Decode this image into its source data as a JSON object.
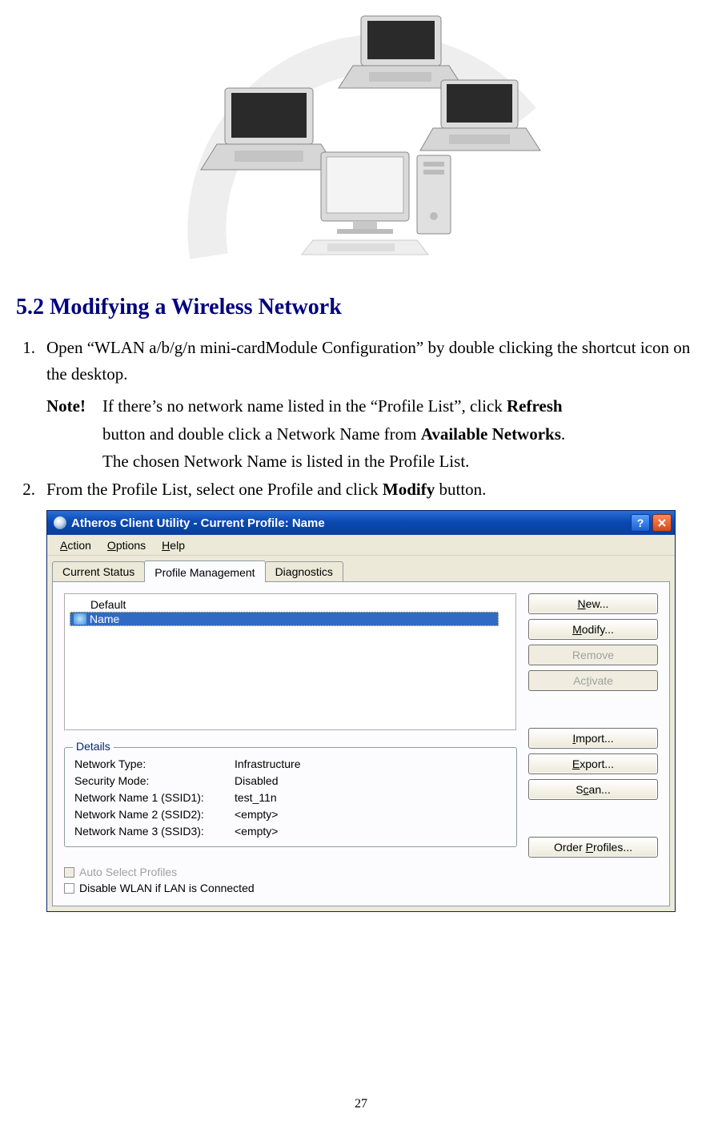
{
  "section_heading": "5.2 Modifying a Wireless Network",
  "steps": {
    "s1_num": "1.",
    "s1_text": "Open “WLAN a/b/g/n mini-cardModule Configuration” by double clicking the shortcut icon on the desktop.",
    "note_label": "Note!",
    "note_l1_pre": "If there’s no network name listed in the “Profile List”, click ",
    "note_l1_bold": "Refresh",
    "note_l2_pre": "button and double click a Network Name from ",
    "note_l2_bold": "Available Networks",
    "note_l2_post": ".",
    "note_l3": "The chosen Network Name is listed in the Profile List.",
    "s2_num": "2.",
    "s2_pre": "From the Profile List, select one Profile and click ",
    "s2_bold": "Modify",
    "s2_post": " button."
  },
  "window": {
    "title": "Atheros Client Utility - Current Profile: Name",
    "menus": {
      "action": "Action",
      "options": "Options",
      "help": "Help"
    },
    "tabs": {
      "status": "Current Status",
      "profile": "Profile Management",
      "diag": "Diagnostics"
    },
    "profiles": {
      "default": "Default",
      "selected": "Name"
    },
    "details": {
      "legend": "Details",
      "rows": [
        {
          "label": "Network Type:",
          "value": "Infrastructure"
        },
        {
          "label": "Security Mode:",
          "value": "Disabled"
        },
        {
          "label": "Network Name 1 (SSID1):",
          "value": "test_11n"
        },
        {
          "label": "Network Name 2 (SSID2):",
          "value": "<empty>"
        },
        {
          "label": "Network Name 3 (SSID3):",
          "value": "<empty>"
        }
      ]
    },
    "buttons": {
      "new": "New...",
      "modify": "Modify...",
      "remove": "Remove",
      "activate": "Activate",
      "import": "Import...",
      "export": "Export...",
      "scan": "Scan...",
      "order": "Order Profiles..."
    },
    "checks": {
      "auto": "Auto Select Profiles",
      "disable": "Disable WLAN if LAN is Connected"
    }
  },
  "page_number": "27"
}
